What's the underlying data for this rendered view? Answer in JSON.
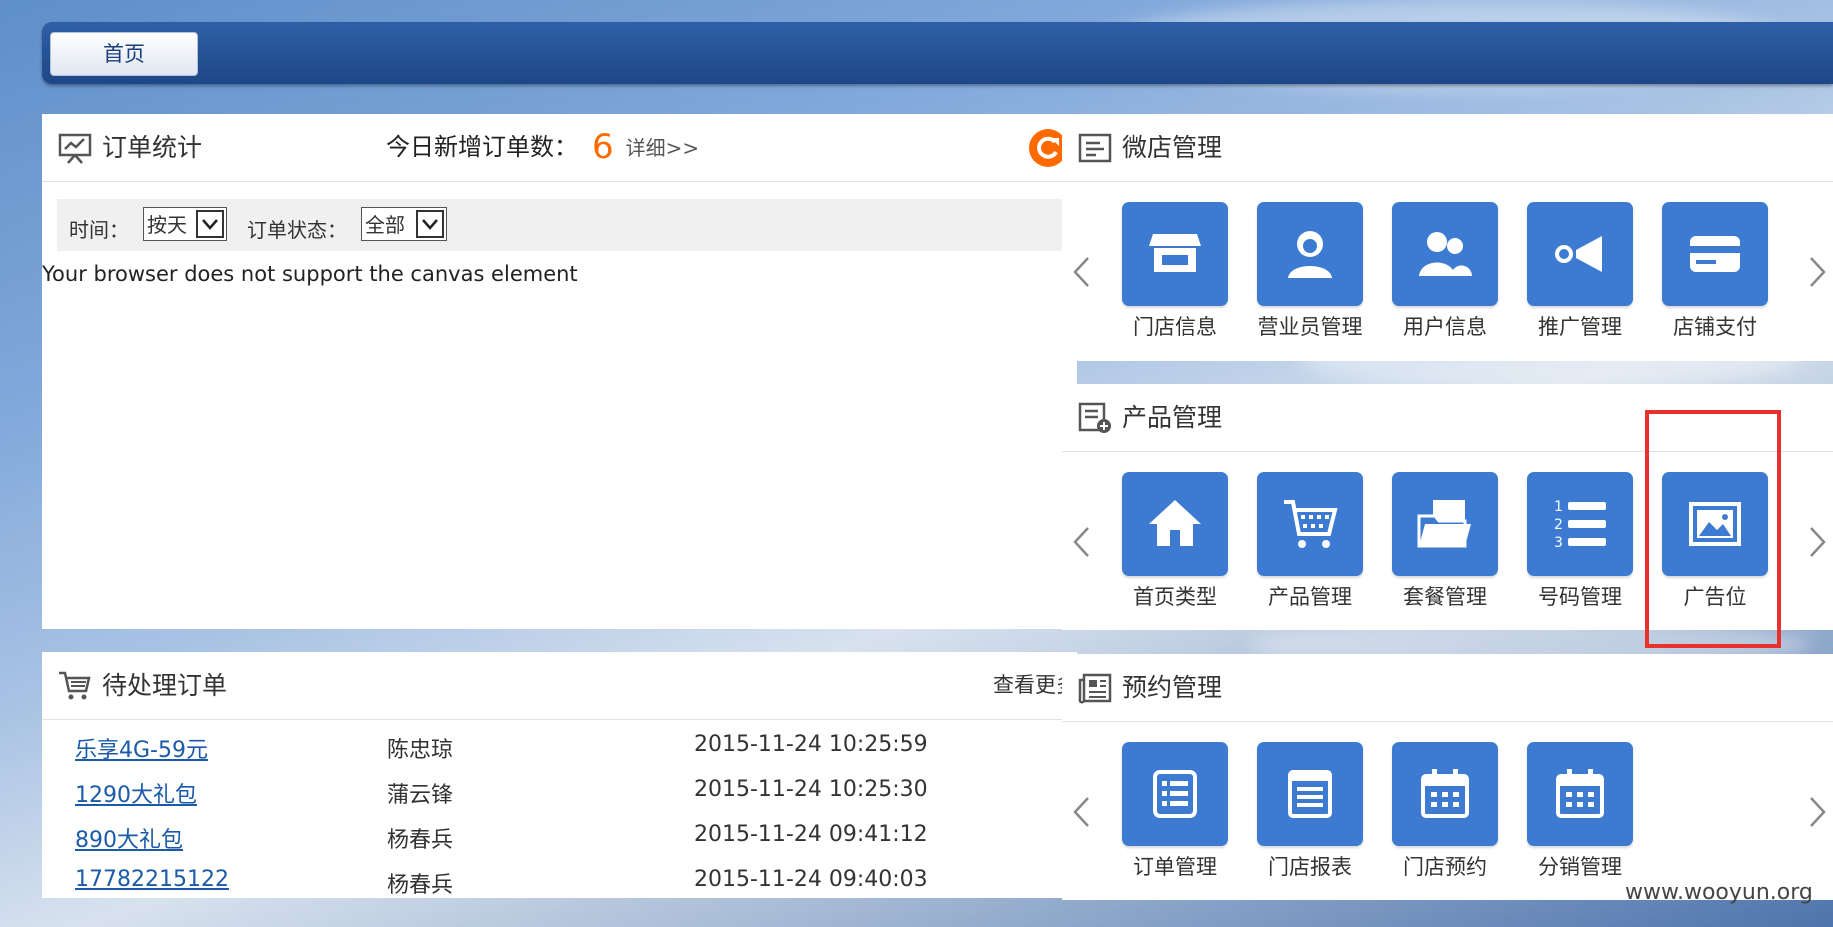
{
  "nav": {
    "home_tab": "首页"
  },
  "order_stats": {
    "title": "订单统计",
    "today_label": "今日新增订单数：",
    "today_count": "6",
    "detail_link": "详细>>",
    "time_label": "时间：",
    "time_value": "按天",
    "status_label": "订单状态：",
    "status_value": "全部",
    "canvas_fallback": "Your browser does not support the canvas element"
  },
  "pending_orders": {
    "title": "待处理订单",
    "more_link": "查看更多",
    "rows": [
      {
        "product": "乐享4G-59元",
        "name": "陈忠琼",
        "time": "2015-11-24 10:25:59"
      },
      {
        "product": "1290大礼包",
        "name": "蒲云锋",
        "time": "2015-11-24 10:25:30"
      },
      {
        "product": "890大礼包",
        "name": "杨春兵",
        "time": "2015-11-24 09:41:12"
      },
      {
        "product": "17782215122",
        "name": "杨春兵",
        "time": "2015-11-24 09:40:03"
      }
    ]
  },
  "weidian": {
    "title": "微店管理",
    "tiles": [
      {
        "label": "门店信息",
        "icon": "store-icon"
      },
      {
        "label": "营业员管理",
        "icon": "user-icon"
      },
      {
        "label": "用户信息",
        "icon": "users-icon"
      },
      {
        "label": "推广管理",
        "icon": "megaphone-icon"
      },
      {
        "label": "店铺支付",
        "icon": "card-icon"
      }
    ]
  },
  "product": {
    "title": "产品管理",
    "tiles": [
      {
        "label": "首页类型",
        "icon": "home-icon"
      },
      {
        "label": "产品管理",
        "icon": "cart-icon"
      },
      {
        "label": "套餐管理",
        "icon": "folder-icon"
      },
      {
        "label": "号码管理",
        "icon": "numbered-list-icon"
      },
      {
        "label": "广告位",
        "icon": "picture-icon"
      }
    ]
  },
  "booking": {
    "title": "预约管理",
    "tiles": [
      {
        "label": "订单管理",
        "icon": "list-doc-icon"
      },
      {
        "label": "门店报表",
        "icon": "report-icon"
      },
      {
        "label": "门店预约",
        "icon": "calendar-icon"
      },
      {
        "label": "分销管理",
        "icon": "calendar-icon"
      }
    ]
  },
  "watermark": "www.wooyun.org",
  "colors": {
    "tile": "#3d7bd3",
    "accent": "#ff6a00",
    "highlight": "#e8312d",
    "topbar": "#1d4788"
  }
}
